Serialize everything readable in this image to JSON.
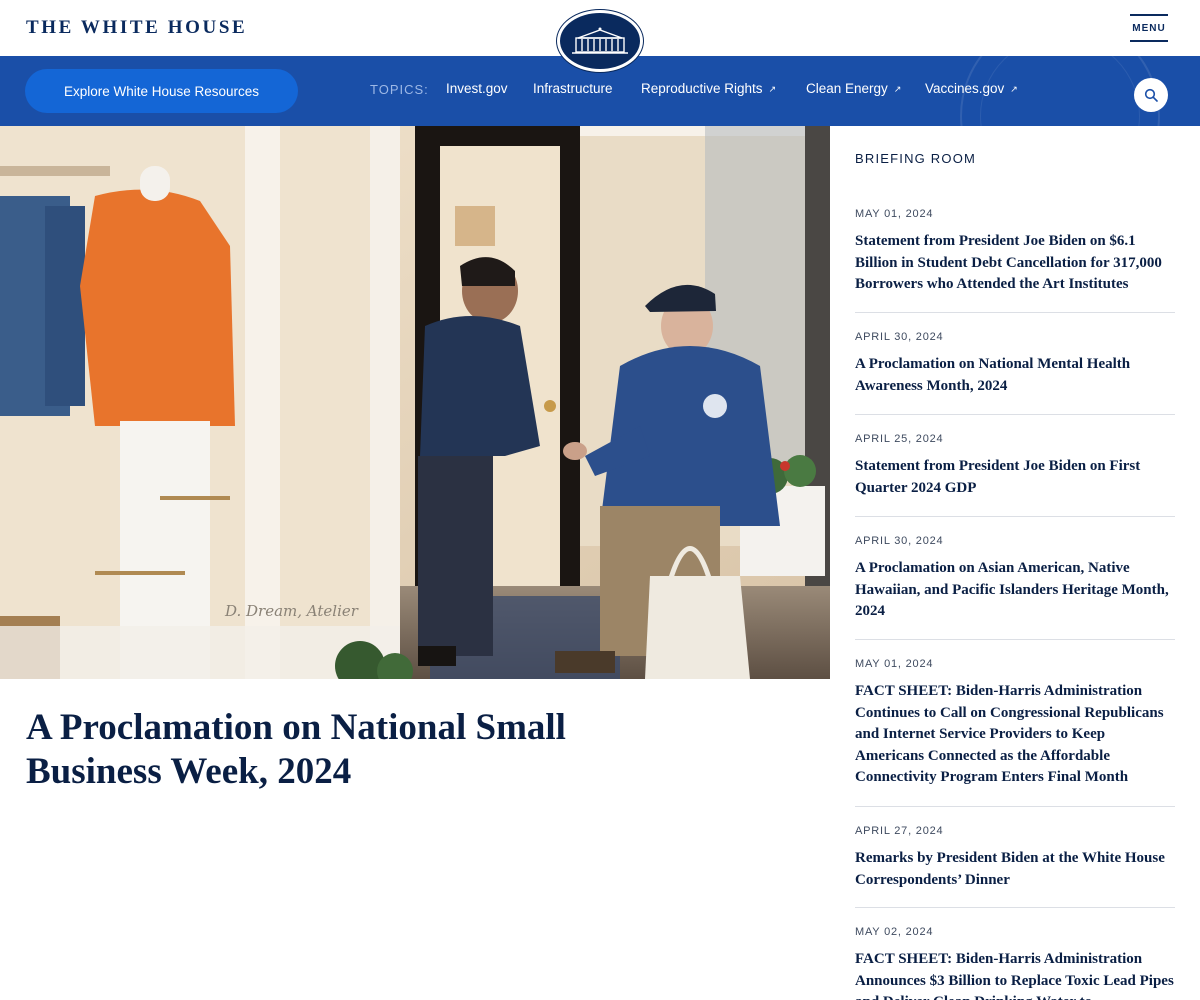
{
  "header": {
    "site_title": "THE WHITE HOUSE",
    "menu_label": "MENU"
  },
  "nav": {
    "explore_label": "Explore White House Resources",
    "topics_label": "TOPICS:",
    "topics": [
      {
        "label": "Invest.gov",
        "external": false
      },
      {
        "label": "Infrastructure",
        "external": false
      },
      {
        "label": "Reproductive Rights",
        "external": true
      },
      {
        "label": "Clean Energy",
        "external": true
      },
      {
        "label": "Vaccines.gov",
        "external": true
      }
    ],
    "external_glyph": "↗",
    "search_icon": "search-icon"
  },
  "hero": {
    "storefront_sign": "D. Dream, Atelier"
  },
  "article": {
    "title": "A Proclamation on National Small Business Week, 2024"
  },
  "briefing": {
    "heading": "BRIEFING ROOM",
    "items": [
      {
        "date": "MAY 01, 2024",
        "title": "Statement from President Joe Biden on $6.1 Billion in Student Debt Cancellation for 317,000 Borrowers who Attended the Art Institutes"
      },
      {
        "date": "APRIL 30, 2024",
        "title": "A Proclamation on National Mental Health Awareness Month, 2024"
      },
      {
        "date": "APRIL 25, 2024",
        "title": "Statement from President Joe Biden on First Quarter 2024 GDP"
      },
      {
        "date": "APRIL 30, 2024",
        "title": "A Proclamation on Asian American, Native Hawaiian, and Pacific Islanders Heritage Month, 2024"
      },
      {
        "date": "MAY 01, 2024",
        "title": "FACT SHEET: Biden-Harris Administration Continues to Call on Congressional Republicans and Internet Service Providers to Keep Americans Connected as the Affordable Connectivity Program Enters Final Month"
      },
      {
        "date": "APRIL 27, 2024",
        "title": "Remarks by President Biden at the White House Correspondents’ Dinner"
      },
      {
        "date": "MAY 02, 2024",
        "title": "FACT SHEET: Biden-Harris Administration Announces $3 Billion to Replace Toxic Lead Pipes and Deliver Clean Drinking Water to Communities Across America"
      }
    ]
  },
  "colors": {
    "navy": "#0a2a5e",
    "nav_blue": "#1a4fa8",
    "button_blue": "#1466d6"
  }
}
